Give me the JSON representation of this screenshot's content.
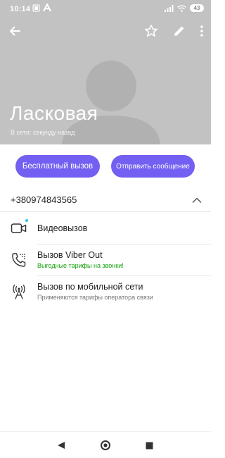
{
  "status_bar": {
    "time": "10:14",
    "battery": "43"
  },
  "contact": {
    "name": "Ласковая",
    "status": "В сети: секунду назад"
  },
  "actions": {
    "free_call": "Бесплатный вызов",
    "send_message": "Отправить сообщение"
  },
  "phone": {
    "number": "+380974843565"
  },
  "options": [
    {
      "title": "Видеовызов",
      "subtitle": "",
      "icon": "video-camera-icon"
    },
    {
      "title": "Вызов Viber Out",
      "subtitle": "Выгодные тарифы на звонки!",
      "icon": "phone-out-icon"
    },
    {
      "title": "Вызов по мобильной сети",
      "subtitle": "Применяются тарифы оператора связи",
      "icon": "cell-tower-icon"
    }
  ],
  "colors": {
    "accent": "#7360f2",
    "header_bg": "#c2c2c2",
    "promo_green": "#13a10e",
    "online_dot": "#2ec4e8"
  }
}
